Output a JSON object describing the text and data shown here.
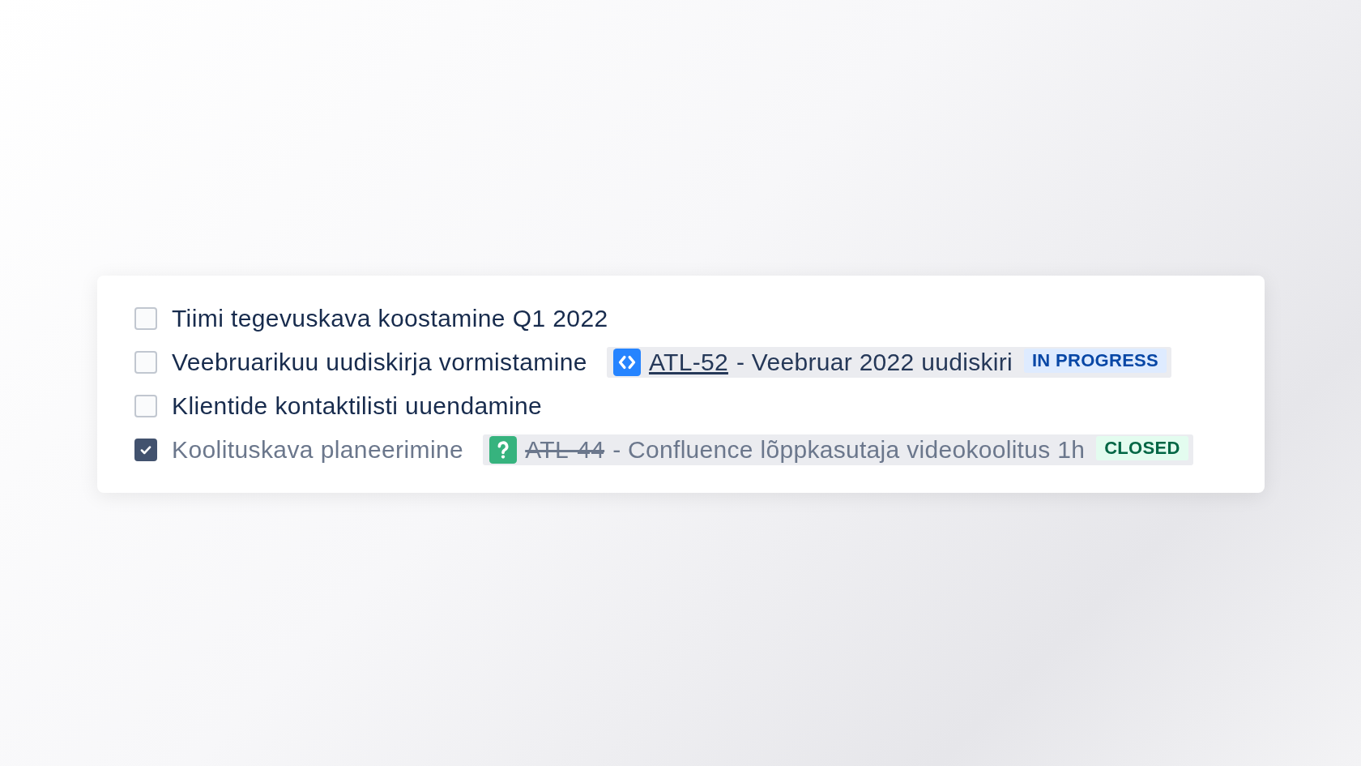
{
  "tasks": [
    {
      "label": "Tiimi tegevuskava koostamine Q1 2022",
      "checked": false
    },
    {
      "label": "Veebruarikuu uudiskirja vormistamine",
      "checked": false,
      "issue": {
        "kind": "code",
        "key": "ATL-52",
        "resolved": false,
        "title": "- Veebruar 2022 uudiskiri",
        "status": {
          "label": "IN PROGRESS",
          "kind": "progress"
        }
      }
    },
    {
      "label": "Klientide kontaktilisti uuendamine",
      "checked": false
    },
    {
      "label": "Koolituskava planeerimine",
      "checked": true,
      "issue": {
        "kind": "question",
        "key": "ATL-44",
        "resolved": true,
        "title": "- Confluence lõppkasutaja videokoolitus 1h",
        "status": {
          "label": "CLOSED",
          "kind": "done"
        }
      }
    }
  ]
}
